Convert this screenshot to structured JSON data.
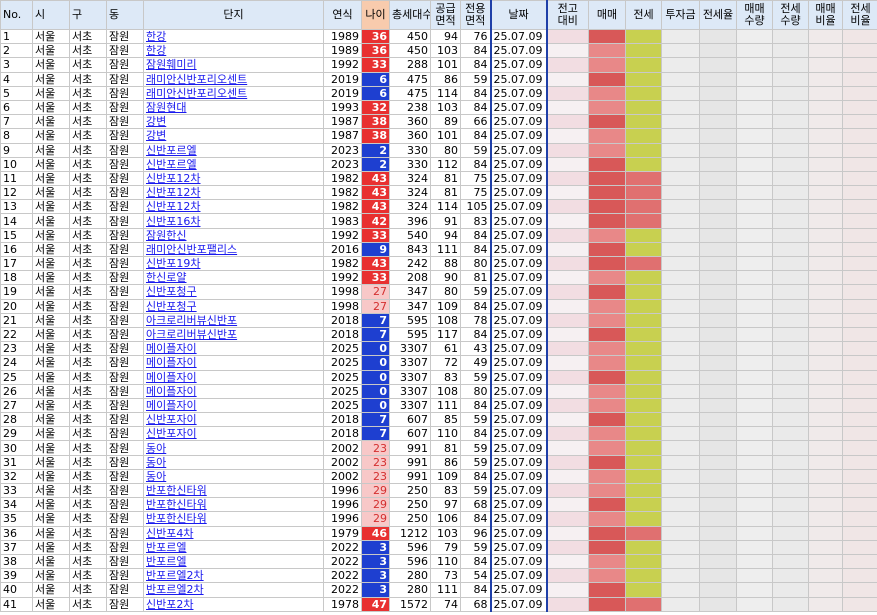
{
  "headers": {
    "no": "No.",
    "si": "시",
    "gu": "구",
    "dong": "동",
    "complex": "단지",
    "year": "연식",
    "age": "나이",
    "households": "총세대수",
    "supply_area": "공급\n면적",
    "exclusive_area": "전용\n면적",
    "date": "날짜",
    "vs_prev": "전고\n대비",
    "sale": "매매",
    "jeonse": "전세",
    "investment": "투자금",
    "jeonse_rate": "전세율",
    "sale_qty": "매매\n수량",
    "jeonse_qty": "전세\n수량",
    "sale_ratio": "매매\n비율",
    "jeonse_ratio": "전세\n비율"
  },
  "colors": {
    "age_new": "#1e3fd0",
    "age_old": "#e83030",
    "age_mid": "#f8c8c8",
    "vs_prev": "#e7a0a8",
    "sale": "#d85858",
    "jeonse": "#c8d050",
    "neutral": "#c8c8c8"
  },
  "rows": [
    {
      "no": "1",
      "si": "서울",
      "gu": "서초",
      "dong": "잠원",
      "name": "한강",
      "year": "1989",
      "age": "36",
      "hh": "450",
      "sup": "94",
      "exc": "76",
      "date": "25.07.09"
    },
    {
      "no": "2",
      "si": "서울",
      "gu": "서초",
      "dong": "잠원",
      "name": "한강",
      "year": "1989",
      "age": "36",
      "hh": "450",
      "sup": "103",
      "exc": "84",
      "date": "25.07.09"
    },
    {
      "no": "3",
      "si": "서울",
      "gu": "서초",
      "dong": "잠원",
      "name": "잠원훼미리",
      "year": "1992",
      "age": "33",
      "hh": "288",
      "sup": "101",
      "exc": "84",
      "date": "25.07.09"
    },
    {
      "no": "4",
      "si": "서울",
      "gu": "서초",
      "dong": "잠원",
      "name": "래미안신반포리오센트",
      "year": "2019",
      "age": "6",
      "hh": "475",
      "sup": "86",
      "exc": "59",
      "date": "25.07.09"
    },
    {
      "no": "5",
      "si": "서울",
      "gu": "서초",
      "dong": "잠원",
      "name": "래미안신반포리오센트",
      "year": "2019",
      "age": "6",
      "hh": "475",
      "sup": "114",
      "exc": "84",
      "date": "25.07.09"
    },
    {
      "no": "6",
      "si": "서울",
      "gu": "서초",
      "dong": "잠원",
      "name": "잠원현대",
      "year": "1993",
      "age": "32",
      "hh": "238",
      "sup": "103",
      "exc": "84",
      "date": "25.07.09"
    },
    {
      "no": "7",
      "si": "서울",
      "gu": "서초",
      "dong": "잠원",
      "name": "강변",
      "year": "1987",
      "age": "38",
      "hh": "360",
      "sup": "89",
      "exc": "66",
      "date": "25.07.09"
    },
    {
      "no": "8",
      "si": "서울",
      "gu": "서초",
      "dong": "잠원",
      "name": "강변",
      "year": "1987",
      "age": "38",
      "hh": "360",
      "sup": "101",
      "exc": "84",
      "date": "25.07.09"
    },
    {
      "no": "9",
      "si": "서울",
      "gu": "서초",
      "dong": "잠원",
      "name": "신반포르엘",
      "year": "2023",
      "age": "2",
      "hh": "330",
      "sup": "80",
      "exc": "59",
      "date": "25.07.09"
    },
    {
      "no": "10",
      "si": "서울",
      "gu": "서초",
      "dong": "잠원",
      "name": "신반포르엘",
      "year": "2023",
      "age": "2",
      "hh": "330",
      "sup": "112",
      "exc": "84",
      "date": "25.07.09"
    },
    {
      "no": "11",
      "si": "서울",
      "gu": "서초",
      "dong": "잠원",
      "name": "신반포12차",
      "year": "1982",
      "age": "43",
      "hh": "324",
      "sup": "81",
      "exc": "75",
      "date": "25.07.09"
    },
    {
      "no": "12",
      "si": "서울",
      "gu": "서초",
      "dong": "잠원",
      "name": "신반포12차",
      "year": "1982",
      "age": "43",
      "hh": "324",
      "sup": "81",
      "exc": "75",
      "date": "25.07.09"
    },
    {
      "no": "13",
      "si": "서울",
      "gu": "서초",
      "dong": "잠원",
      "name": "신반포12차",
      "year": "1982",
      "age": "43",
      "hh": "324",
      "sup": "114",
      "exc": "105",
      "date": "25.07.09"
    },
    {
      "no": "14",
      "si": "서울",
      "gu": "서초",
      "dong": "잠원",
      "name": "신반포16차",
      "year": "1983",
      "age": "42",
      "hh": "396",
      "sup": "91",
      "exc": "83",
      "date": "25.07.09"
    },
    {
      "no": "15",
      "si": "서울",
      "gu": "서초",
      "dong": "잠원",
      "name": "잠원한신",
      "year": "1992",
      "age": "33",
      "hh": "540",
      "sup": "94",
      "exc": "84",
      "date": "25.07.09"
    },
    {
      "no": "16",
      "si": "서울",
      "gu": "서초",
      "dong": "잠원",
      "name": "래미안신반포팰리스",
      "year": "2016",
      "age": "9",
      "hh": "843",
      "sup": "111",
      "exc": "84",
      "date": "25.07.09"
    },
    {
      "no": "17",
      "si": "서울",
      "gu": "서초",
      "dong": "잠원",
      "name": "신반포19차",
      "year": "1982",
      "age": "43",
      "hh": "242",
      "sup": "88",
      "exc": "80",
      "date": "25.07.09"
    },
    {
      "no": "18",
      "si": "서울",
      "gu": "서초",
      "dong": "잠원",
      "name": "한신로얄",
      "year": "1992",
      "age": "33",
      "hh": "208",
      "sup": "90",
      "exc": "81",
      "date": "25.07.09"
    },
    {
      "no": "19",
      "si": "서울",
      "gu": "서초",
      "dong": "잠원",
      "name": "신반포청구",
      "year": "1998",
      "age": "27",
      "hh": "347",
      "sup": "80",
      "exc": "59",
      "date": "25.07.09"
    },
    {
      "no": "20",
      "si": "서울",
      "gu": "서초",
      "dong": "잠원",
      "name": "신반포청구",
      "year": "1998",
      "age": "27",
      "hh": "347",
      "sup": "109",
      "exc": "84",
      "date": "25.07.09"
    },
    {
      "no": "21",
      "si": "서울",
      "gu": "서초",
      "dong": "잠원",
      "name": "아크로리버뷰신반포",
      "year": "2018",
      "age": "7",
      "hh": "595",
      "sup": "108",
      "exc": "78",
      "date": "25.07.09"
    },
    {
      "no": "22",
      "si": "서울",
      "gu": "서초",
      "dong": "잠원",
      "name": "아크로리버뷰신반포",
      "year": "2018",
      "age": "7",
      "hh": "595",
      "sup": "117",
      "exc": "84",
      "date": "25.07.09"
    },
    {
      "no": "23",
      "si": "서울",
      "gu": "서초",
      "dong": "잠원",
      "name": "메이플자이",
      "year": "2025",
      "age": "0",
      "hh": "3307",
      "sup": "61",
      "exc": "43",
      "date": "25.07.09"
    },
    {
      "no": "24",
      "si": "서울",
      "gu": "서초",
      "dong": "잠원",
      "name": "메이플자이",
      "year": "2025",
      "age": "0",
      "hh": "3307",
      "sup": "72",
      "exc": "49",
      "date": "25.07.09"
    },
    {
      "no": "25",
      "si": "서울",
      "gu": "서초",
      "dong": "잠원",
      "name": "메이플자이",
      "year": "2025",
      "age": "0",
      "hh": "3307",
      "sup": "83",
      "exc": "59",
      "date": "25.07.09"
    },
    {
      "no": "26",
      "si": "서울",
      "gu": "서초",
      "dong": "잠원",
      "name": "메이플자이",
      "year": "2025",
      "age": "0",
      "hh": "3307",
      "sup": "108",
      "exc": "80",
      "date": "25.07.09"
    },
    {
      "no": "27",
      "si": "서울",
      "gu": "서초",
      "dong": "잠원",
      "name": "메이플자이",
      "year": "2025",
      "age": "0",
      "hh": "3307",
      "sup": "111",
      "exc": "84",
      "date": "25.07.09"
    },
    {
      "no": "28",
      "si": "서울",
      "gu": "서초",
      "dong": "잠원",
      "name": "신반포자이",
      "year": "2018",
      "age": "7",
      "hh": "607",
      "sup": "85",
      "exc": "59",
      "date": "25.07.09"
    },
    {
      "no": "29",
      "si": "서울",
      "gu": "서초",
      "dong": "잠원",
      "name": "신반포자이",
      "year": "2018",
      "age": "7",
      "hh": "607",
      "sup": "110",
      "exc": "84",
      "date": "25.07.09"
    },
    {
      "no": "30",
      "si": "서울",
      "gu": "서초",
      "dong": "잠원",
      "name": "동아",
      "year": "2002",
      "age": "23",
      "hh": "991",
      "sup": "81",
      "exc": "59",
      "date": "25.07.09"
    },
    {
      "no": "31",
      "si": "서울",
      "gu": "서초",
      "dong": "잠원",
      "name": "동아",
      "year": "2002",
      "age": "23",
      "hh": "991",
      "sup": "86",
      "exc": "59",
      "date": "25.07.09"
    },
    {
      "no": "32",
      "si": "서울",
      "gu": "서초",
      "dong": "잠원",
      "name": "동아",
      "year": "2002",
      "age": "23",
      "hh": "991",
      "sup": "109",
      "exc": "84",
      "date": "25.07.09"
    },
    {
      "no": "33",
      "si": "서울",
      "gu": "서초",
      "dong": "잠원",
      "name": "반포한신타워",
      "year": "1996",
      "age": "29",
      "hh": "250",
      "sup": "83",
      "exc": "59",
      "date": "25.07.09"
    },
    {
      "no": "34",
      "si": "서울",
      "gu": "서초",
      "dong": "잠원",
      "name": "반포한신타워",
      "year": "1996",
      "age": "29",
      "hh": "250",
      "sup": "97",
      "exc": "68",
      "date": "25.07.09"
    },
    {
      "no": "35",
      "si": "서울",
      "gu": "서초",
      "dong": "잠원",
      "name": "반포한신타워",
      "year": "1996",
      "age": "29",
      "hh": "250",
      "sup": "106",
      "exc": "84",
      "date": "25.07.09"
    },
    {
      "no": "36",
      "si": "서울",
      "gu": "서초",
      "dong": "잠원",
      "name": "신반포4차",
      "year": "1979",
      "age": "46",
      "hh": "1212",
      "sup": "103",
      "exc": "96",
      "date": "25.07.09"
    },
    {
      "no": "37",
      "si": "서울",
      "gu": "서초",
      "dong": "잠원",
      "name": "반포르엘",
      "year": "2022",
      "age": "3",
      "hh": "596",
      "sup": "79",
      "exc": "59",
      "date": "25.07.09"
    },
    {
      "no": "38",
      "si": "서울",
      "gu": "서초",
      "dong": "잠원",
      "name": "반포르엘",
      "year": "2022",
      "age": "3",
      "hh": "596",
      "sup": "110",
      "exc": "84",
      "date": "25.07.09"
    },
    {
      "no": "39",
      "si": "서울",
      "gu": "서초",
      "dong": "잠원",
      "name": "반포르엘2차",
      "year": "2022",
      "age": "3",
      "hh": "280",
      "sup": "73",
      "exc": "54",
      "date": "25.07.09"
    },
    {
      "no": "40",
      "si": "서울",
      "gu": "서초",
      "dong": "잠원",
      "name": "반포르엘2차",
      "year": "2022",
      "age": "3",
      "hh": "280",
      "sup": "111",
      "exc": "84",
      "date": "25.07.09"
    },
    {
      "no": "41",
      "si": "서울",
      "gu": "서초",
      "dong": "잠원",
      "name": "신반포2차",
      "year": "1978",
      "age": "47",
      "hh": "1572",
      "sup": "74",
      "exc": "68",
      "date": "25.07.09"
    }
  ]
}
